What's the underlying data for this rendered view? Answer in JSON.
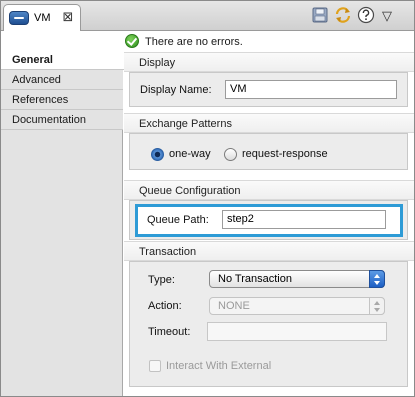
{
  "tab": {
    "title": "VM",
    "close_glyph": "⊠",
    "icon": "vm-endpoint-icon"
  },
  "toolbar": {
    "icons": [
      "save-icon",
      "refresh-icon",
      "help-icon",
      "view-menu-icon"
    ],
    "more_glyph": "▽"
  },
  "status": {
    "icon": "check-circle-icon",
    "text": "There are no errors."
  },
  "sidebar": {
    "items": [
      {
        "label": "General",
        "active": true
      },
      {
        "label": "Advanced",
        "active": false
      },
      {
        "label": "References",
        "active": false
      },
      {
        "label": "Documentation",
        "active": false
      }
    ]
  },
  "display": {
    "header": "Display",
    "name_label": "Display Name:",
    "name_value": "VM"
  },
  "exchange": {
    "header": "Exchange Patterns",
    "options": [
      {
        "label": "one-way",
        "checked": true
      },
      {
        "label": "request-response",
        "checked": false
      }
    ]
  },
  "queue": {
    "header": "Queue Configuration",
    "path_label": "Queue Path:",
    "path_value": "step2"
  },
  "transaction": {
    "header": "Transaction",
    "type_label": "Type:",
    "type_value": "No Transaction",
    "action_label": "Action:",
    "action_value": "NONE",
    "timeout_label": "Timeout:",
    "timeout_value": "",
    "interact_label": "Interact With External",
    "interact_checked": false
  },
  "colors": {
    "highlight_border": "#2e9bd6",
    "select_button": "#1d5fc4",
    "status_ok": "#2f8f1f"
  }
}
